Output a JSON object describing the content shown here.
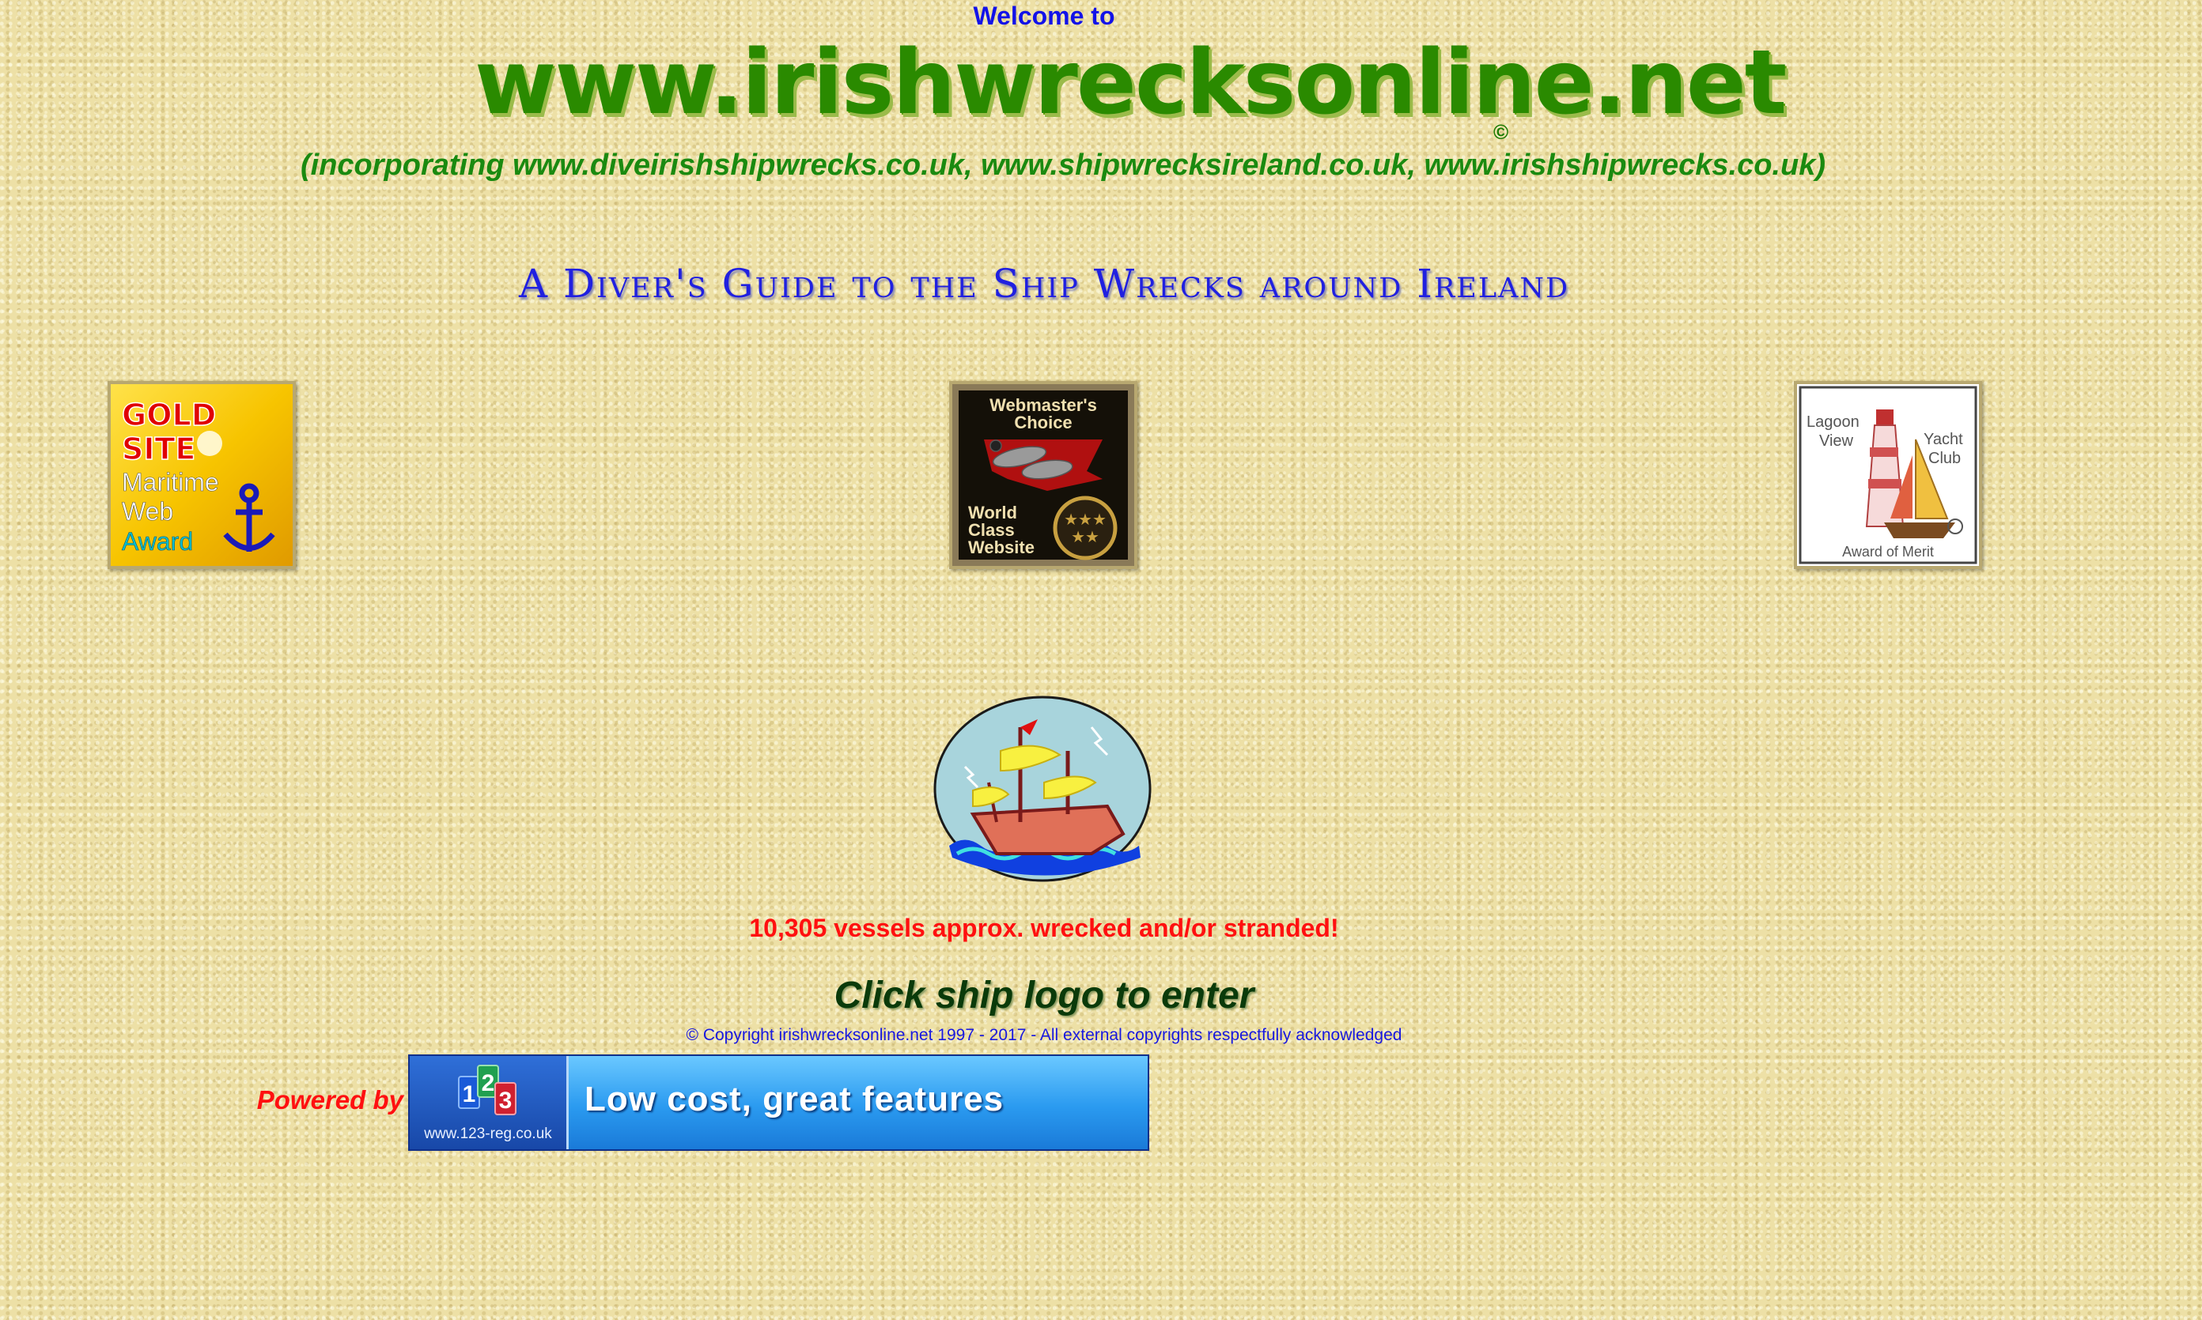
{
  "header": {
    "welcome": "Welcome to",
    "logo_text": "www.irishwrecksonline.net",
    "copyright_mark": "©",
    "incorporating": "(incorporating www.diveirishshipwrecks.co.uk, www.shipwrecksireland.co.uk, www.irishshipwrecks.co.uk)"
  },
  "tagline": "A Diver's Guide to the Ship Wrecks around Ireland",
  "awards": {
    "gold": {
      "line1": "GOLD",
      "line2": "SITE",
      "line3": "Maritime",
      "line4": "Web",
      "line5": "Award"
    },
    "webmaster": {
      "line1": "Webmaster's",
      "line2": "Choice",
      "line3": "World",
      "line4": "Class",
      "line5": "Website"
    },
    "lagoon": {
      "line1": "Lagoon",
      "line2": "View",
      "line3": "Yacht",
      "line4": "Club",
      "line5": "Award of Merit"
    }
  },
  "vessels_text": "10,305 vessels approx. wrecked and/or stranded!",
  "enter_text": "Click ship logo to enter",
  "copyright_text": "© Copyright irishwrecksonline.net 1997 - 2017 - All external copyrights respectfully acknowledged",
  "powered_by": "Powered by",
  "banner": {
    "logo_digits": [
      "1",
      "2",
      "3"
    ],
    "url": "www.123-reg.co.uk",
    "headline": "Low cost, great features"
  },
  "colors": {
    "background": "#ede0a6",
    "title_green": "#2a8a00",
    "tagline_blue": "#2020e0",
    "alert_red": "#ff1010"
  }
}
